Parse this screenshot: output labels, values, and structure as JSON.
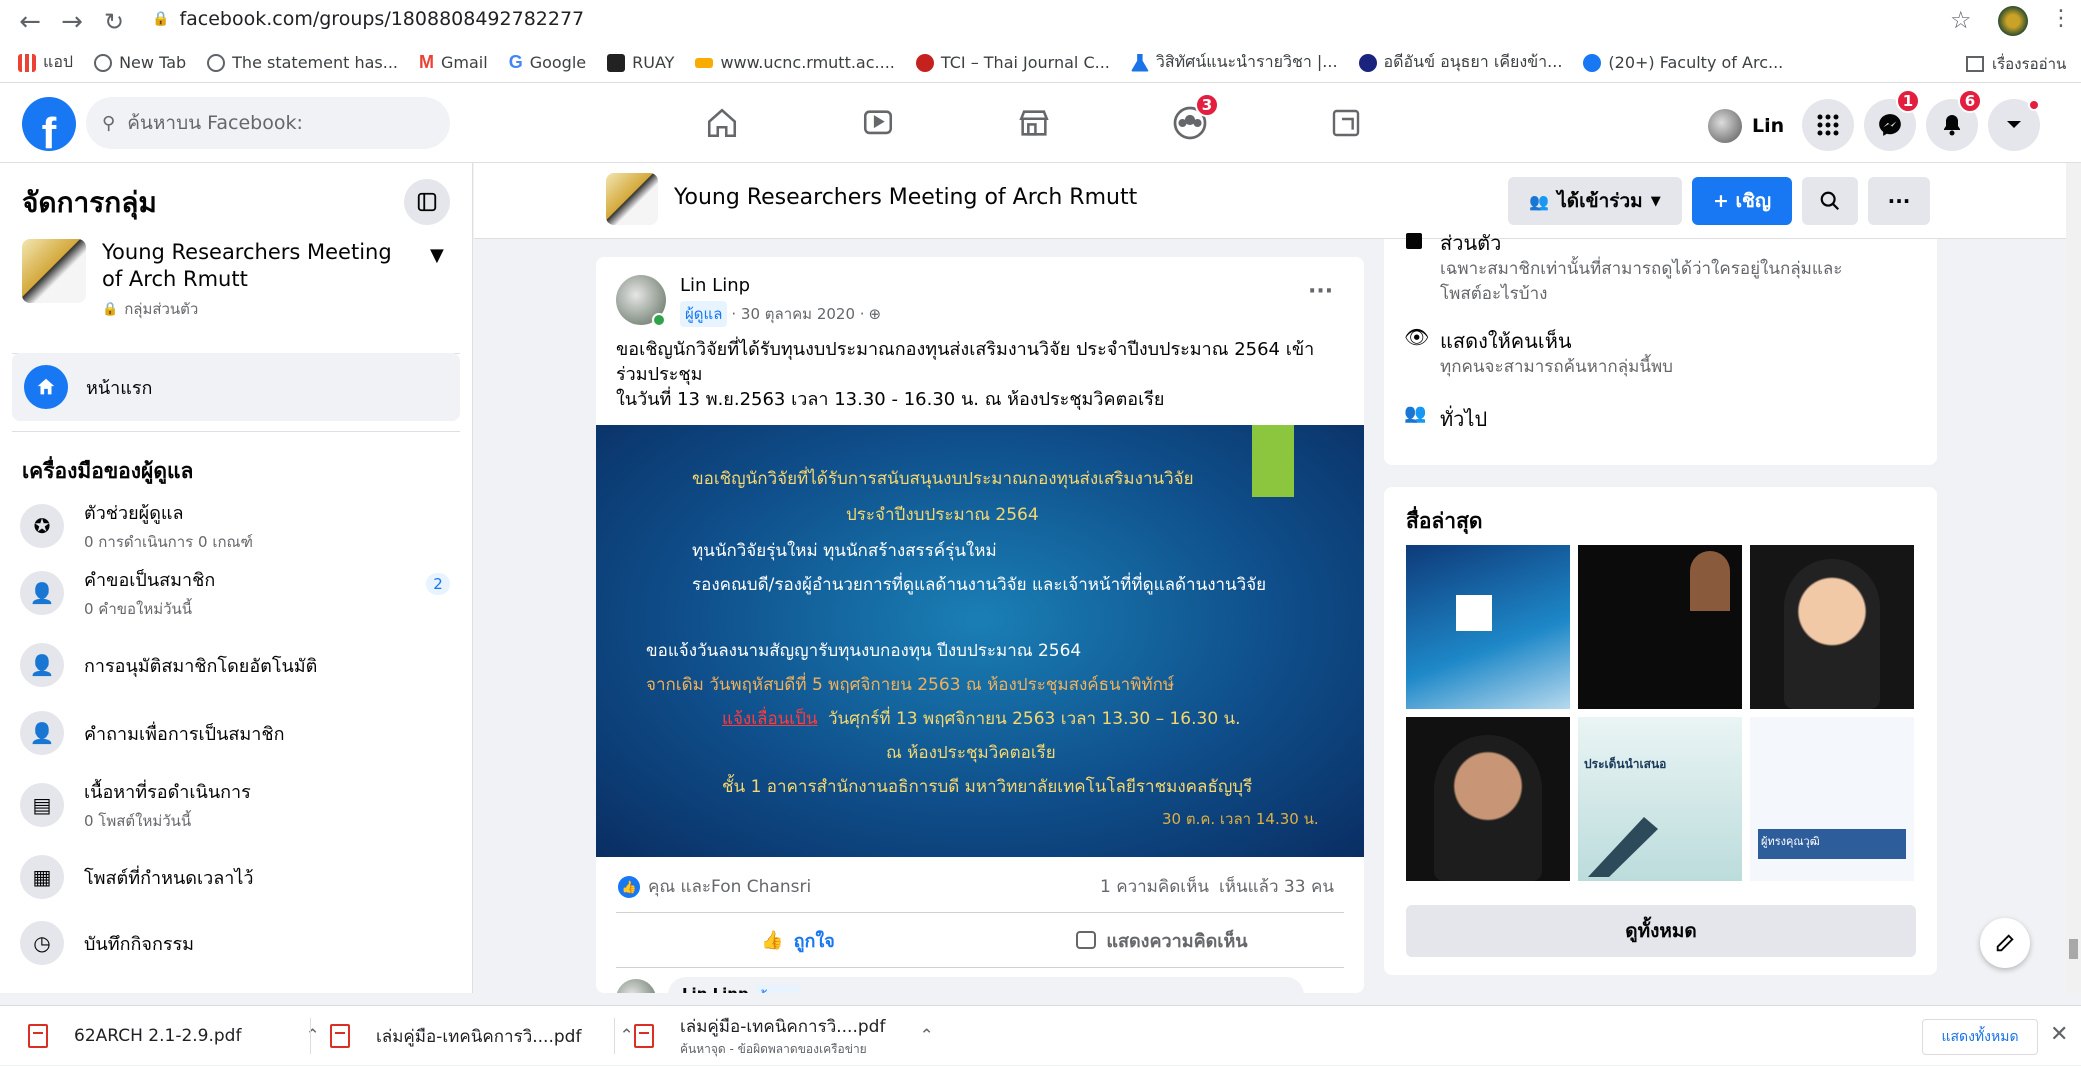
{
  "browser": {
    "url": "facebook.com/groups/1808808492782277"
  },
  "bookmarks": [
    {
      "label": "แอป",
      "color": "#4285f4"
    },
    {
      "label": "New Tab",
      "color": "#5f6368"
    },
    {
      "label": "The statement has...",
      "color": "#5f6368"
    },
    {
      "label": "Gmail",
      "color": "#ea4335"
    },
    {
      "label": "Google",
      "color": "#34a853"
    },
    {
      "label": "RUAY",
      "color": "#222222"
    },
    {
      "label": "www.ucnc.rmutt.ac....",
      "color": "#f9ab00"
    },
    {
      "label": "TCI – Thai Journal C...",
      "color": "#c5221f"
    },
    {
      "label": "วิสิทัศน์แนะนำรายวิชา |...",
      "color": "#1a73e8"
    },
    {
      "label": "อดีอันข์ อนุธยา เคียงข้า...",
      "color": "#1a237e"
    },
    {
      "label": "(20+) Faculty of Arc...",
      "color": "#1877f2"
    }
  ],
  "bookmarks_right": "เรื่องรออ่าน",
  "fb": {
    "search_placeholder": "ค้นหาบน Facebook:",
    "groups_badge": "3",
    "user": "Lin",
    "messenger_badge": "1",
    "notif_badge": "6"
  },
  "sidebar": {
    "title": "จัดการกลุ่ม",
    "group_name": "Young Researchers Meeting of Arch Rmutt",
    "group_privacy": "กลุ่มส่วนตัว",
    "home": "หน้าแรก",
    "admin_tools_title": "เครื่องมือของผู้ดูแล",
    "tools": [
      {
        "name": "ตัวช่วยผู้ดูแล",
        "sub": "0 การดำเนินการ 0 เกณฑ์",
        "icon": "admin-assist-icon",
        "glyph": "✪",
        "count": ""
      },
      {
        "name": "คำขอเป็นสมาชิก",
        "sub": "0 คำขอใหม่วันนี้",
        "icon": "member-request-icon",
        "glyph": "👤",
        "count": "2"
      },
      {
        "name": "การอนุมัติสมาชิกโดยอัตโนมัติ",
        "sub": "",
        "icon": "auto-approve-icon",
        "glyph": "👤",
        "count": ""
      },
      {
        "name": "คำถามเพื่อการเป็นสมาชิก",
        "sub": "",
        "icon": "membership-question-icon",
        "glyph": "👤",
        "count": ""
      },
      {
        "name": "เนื้อหาที่รอดำเนินการ",
        "sub": "0 โพสต์ใหม่วันนี้",
        "icon": "pending-content-icon",
        "glyph": "▤",
        "count": ""
      },
      {
        "name": "โพสต์ที่กำหนดเวลาไว้",
        "sub": "",
        "icon": "scheduled-post-icon",
        "glyph": "▦",
        "count": ""
      },
      {
        "name": "บันทึกกิจกรรม",
        "sub": "",
        "icon": "activity-log-icon",
        "glyph": "◷",
        "count": ""
      }
    ]
  },
  "group_header": {
    "name": "Young Researchers Meeting of Arch Rmutt",
    "joined": "ได้เข้าร่วม",
    "invite": "+ เชิญ"
  },
  "post": {
    "author": "Lin Linp",
    "role": "ผู้ดูแล",
    "date": "· 30 ตุลาคม 2020 ·",
    "text1": "ขอเชิญนักวิจัยที่ได้รับทุนงบประมาณกองทุนส่งเสริมงานวิจัย ประจำปีงบประมาณ 2564 เข้า",
    "text2": "ร่วมประชุม",
    "text3": "ในวันที่ 13 พ.ย.2563 เวลา 13.30 - 16.30 น. ณ ห้องประชุมวิคตอเรีย",
    "image_lines": [
      "ขอเชิญนักวิจัยที่ได้รับการสนับสนุนงบประมาณกองทุนส่งเสริมงานวิจัย",
      "ประจำปีงบประมาณ 2564",
      "ทุนนักวิจัยรุ่นใหม่ ทุนนักสร้างสรรค์รุ่นใหม่",
      "รองคณบดี/รองผู้อำนวยการที่ดูแลด้านงานวิจัย และเจ้าหน้าที่ที่ดูแลด้านงานวิจัย",
      "ขอแจ้งวันลงนามสัญญารับทุนงบกองทุน ปีงบประมาณ 2564",
      "จากเดิม วันพฤหัสบดีที่ 5 พฤศจิกายน 2563 ณ ห้องประชุมสงค์ธนาพิทักษ์",
      "แจ้งเลื่อนเป็น",
      "วันศุกร์ที่ 13 พฤศจิกายน 2563 เวลา 13.30 – 16.30 น.",
      "ณ ห้องประชุมวิคตอเรีย",
      "ชั้น 1 อาคารสำนักงานอธิการบดี มหาวิทยาลัยเทคโนโลยีราชมงคลธัญบุรี",
      "30 ต.ค. เวลา 14.30 น."
    ],
    "reactions": "คุณ และFon Chansri",
    "comments": "1 ความคิดเห็น",
    "views": "เห็นแล้ว 33 คน",
    "like": "ถูกใจ",
    "comment": "แสดงความคิดเห็น",
    "next_author": "Lin Linp",
    "next_role": "ผู้ดูแล"
  },
  "about": {
    "private_title": "ส่วนตัว",
    "private_desc1": "เฉพาะสมาชิกเท่านั้นที่สามารถดูได้ว่าใครอยู่ในกลุ่มและ",
    "private_desc2": "โพสต์อะไรบ้าง",
    "visible_title": "แสดงให้คนเห็น",
    "visible_desc": "ทุกคนจะสามารถค้นหากลุ่มนี้พบ",
    "general": "ทั่วไป"
  },
  "media": {
    "title": "สื่อล่าสุด",
    "see_all": "ดูทั้งหมด",
    "thumb2_text": "ประเด็นนำเสนอ",
    "thumb3_text": "ผู้ทรงคุณวุฒิ"
  },
  "downloads": {
    "items": [
      {
        "name": "62ARCH 2.1-2.9.pdf",
        "sub": ""
      },
      {
        "name": "เล่มคู่มือ-เทคนิคการวิ....pdf",
        "sub": ""
      },
      {
        "name": "เล่มคู่มือ-เทคนิคการวิ....pdf",
        "sub": "ค้นหาจุด - ข้อผิดพลาดของเครือข่าย"
      }
    ],
    "show_all": "แสดงทั้งหมด"
  },
  "colors": {
    "fb_blue": "#1877f2",
    "badge_red": "#e41e3f",
    "bg": "#f0f2f5"
  }
}
